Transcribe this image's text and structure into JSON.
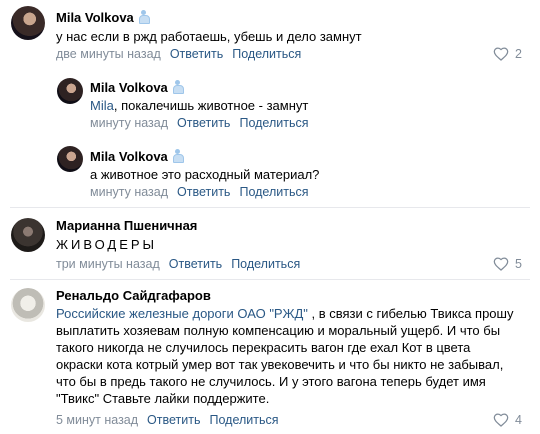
{
  "comments": [
    {
      "author": "Mila Volkova",
      "text": "у нас если в ржд работаешь, убешь и дело замнут",
      "time": "две минуты назад",
      "reply": "Ответить",
      "share": "Поделиться",
      "likes": "2"
    },
    {
      "author": "Mila Volkova",
      "mention": "Mila",
      "text": ", покалечишь животное - замнут",
      "time": "минуту назад",
      "reply": "Ответить",
      "share": "Поделиться"
    },
    {
      "author": "Mila Volkova",
      "text": "а животное это расходный материал?",
      "time": "минуту назад",
      "reply": "Ответить",
      "share": "Поделиться"
    },
    {
      "author": "Марианна Пшеничная",
      "text": "ЖИВОДЕРЫ",
      "time": "три минуты назад",
      "reply": "Ответить",
      "share": "Поделиться",
      "likes": "5"
    },
    {
      "author": "Ренальдо Сайдгафаров",
      "mention": "Российские железные дороги ОАО \"РЖД\"",
      "text_lines": [
        ", в связи с гибелью Твикса прошу",
        "выплатить хозяевам полную компенсацию и моральный ущерб. И что бы",
        "такого никогда не случилось перекрасить вагон где ехал Кот в цвета",
        "окраски кота котрый умер вот так увековечить и что бы никто не забывал,",
        "что бы в предь такого не случилось. И у этого вагона теперь будет имя",
        "\"Твикс\" Ставьте лайки поддержите."
      ],
      "time": "5 минут назад",
      "reply": "Ответить",
      "share": "Поделиться",
      "likes": "4"
    }
  ],
  "colors": {
    "link": "#2a5885",
    "meta": "#818c99",
    "divider": "#e7e8ec"
  },
  "icons": {
    "like": "heart-icon",
    "verified": "badge-icon"
  }
}
